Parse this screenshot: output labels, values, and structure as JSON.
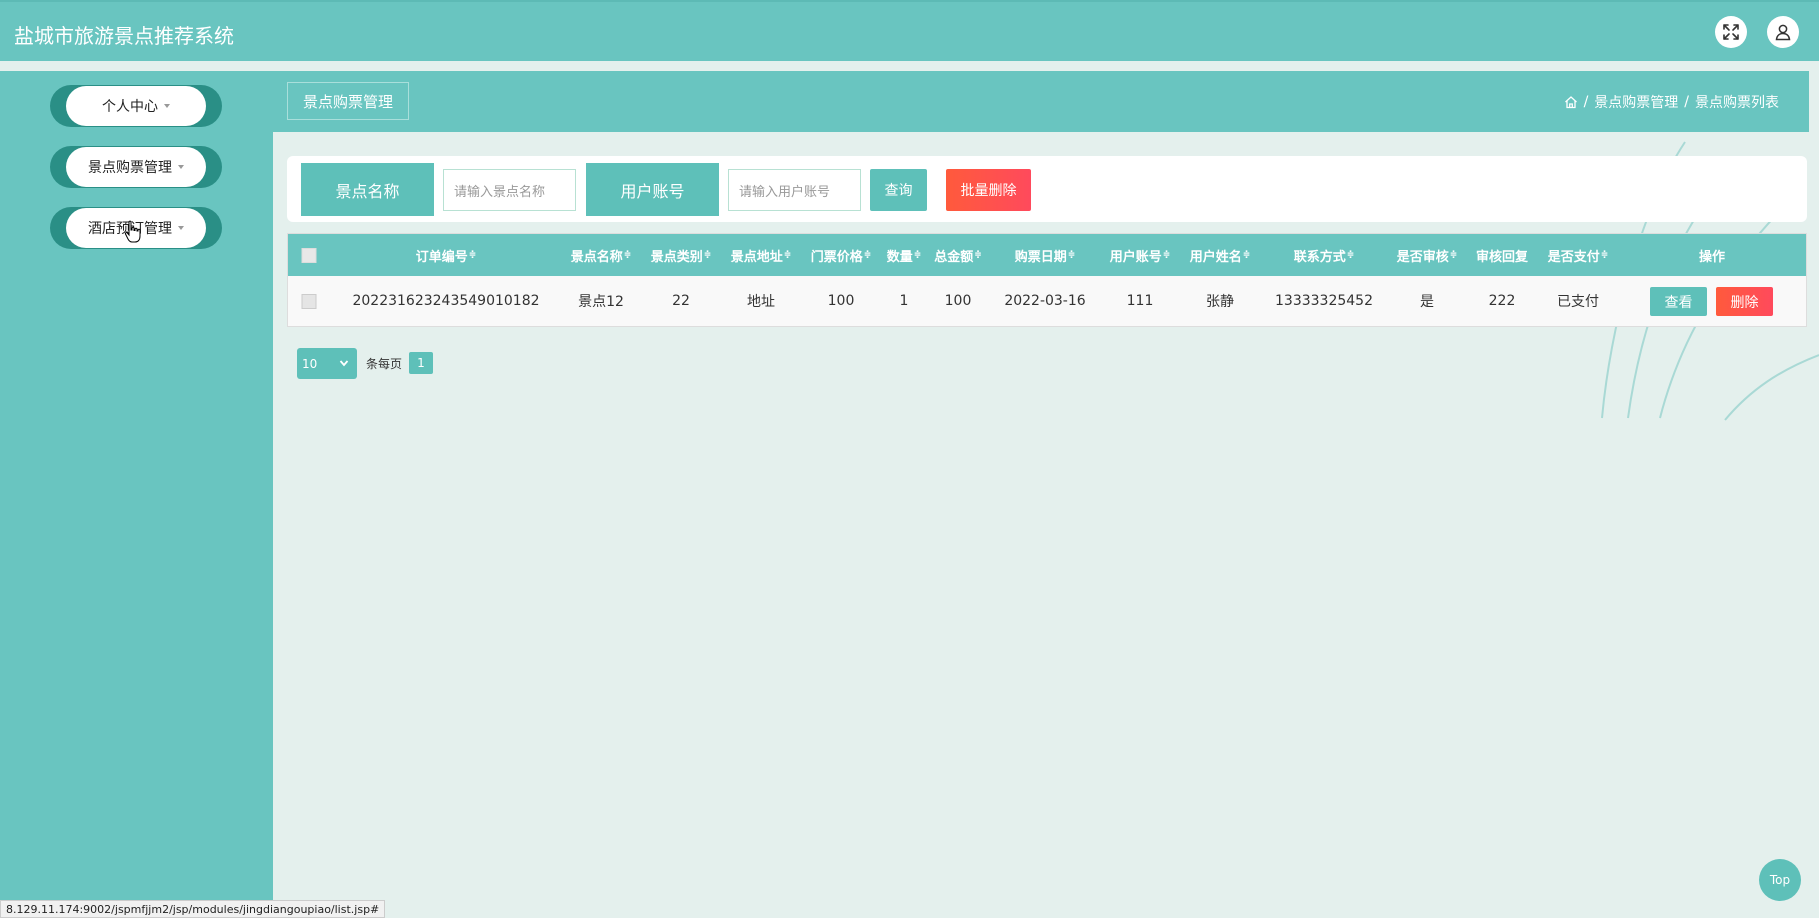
{
  "app": {
    "title": "盐城市旅游景点推荐系统"
  },
  "header_icons": [
    "fullscreen-icon",
    "user-icon"
  ],
  "sidebar": {
    "items": [
      {
        "label": "个人中心"
      },
      {
        "label": "景点购票管理"
      },
      {
        "label": "酒店预订管理"
      }
    ]
  },
  "page": {
    "tab_label": "景点购票管理",
    "breadcrumb": {
      "sep": "/",
      "items": [
        "景点购票管理",
        "景点购票列表"
      ]
    }
  },
  "search": {
    "name_label": "景点名称",
    "name_placeholder": "请输入景点名称",
    "account_label": "用户账号",
    "account_placeholder": "请输入用户账号",
    "query_button": "查询",
    "batch_delete_button": "批量删除"
  },
  "table": {
    "sort_icon": "≑",
    "columns": [
      "订单编号",
      "景点名称",
      "景点类别",
      "景点地址",
      "门票价格",
      "数量",
      "总金额",
      "购票日期",
      "用户账号",
      "用户姓名",
      "联系方式",
      "是否审核",
      "审核回复",
      "是否支付",
      "操作"
    ],
    "rows": [
      [
        "202231623243549010182",
        "景点12",
        "22",
        "地址",
        "100",
        "1",
        "100",
        "2022-03-16",
        "111",
        "张静",
        "13333325452",
        "是",
        "222",
        "已支付"
      ]
    ],
    "view_button": "查看",
    "delete_button": "删除"
  },
  "pagination": {
    "page_size": "10",
    "per_page_label": "条每页",
    "current_page": "1"
  },
  "top_button": "Top",
  "status_url": "8.129.11.174:9002/jspmfjjm2/jsp/modules/jingdiangoupiao/list.jsp#",
  "colors": {
    "primary": "#69c5c0",
    "button": "#5ec0b9",
    "danger": "#ff5a4a",
    "menu_border": "#2a8f86"
  }
}
